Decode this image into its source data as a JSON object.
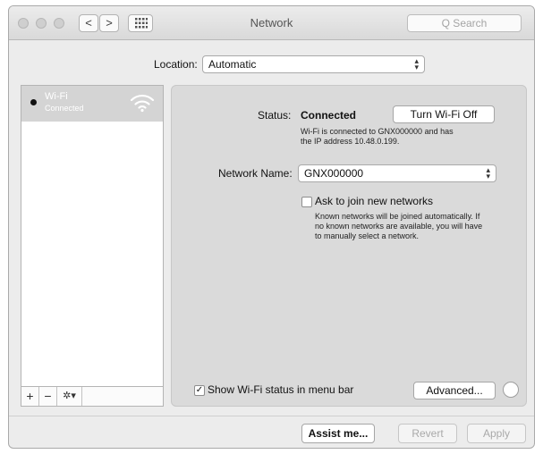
{
  "window": {
    "title": "Network"
  },
  "toolbar": {
    "back": "<",
    "forward": ">",
    "search_placeholder": "Q  Search"
  },
  "location": {
    "label": "Location:",
    "value": "Automatic"
  },
  "sidebar": {
    "items": [
      {
        "name": "Wi-Fi",
        "status": "Connected"
      }
    ],
    "add": "+",
    "remove": "−",
    "action": "✲▾"
  },
  "status": {
    "label": "Status:",
    "value": "Connected",
    "button": "Turn Wi-Fi Off",
    "desc_line1": "Wi-Fi is connected to GNX000000 and has",
    "desc_line2": "the IP address 10.48.0.199."
  },
  "network": {
    "label": "Network Name:",
    "value": "GNX000000",
    "ask_label": "Ask to join new networks",
    "ask_checked": false,
    "ask_desc_line1": "Known networks will be joined automatically. If",
    "ask_desc_line2": "no known networks are available, you will have",
    "ask_desc_line3": "to manually select a network."
  },
  "show_status": {
    "label": "Show Wi-Fi status in menu bar",
    "checked": true,
    "check_glyph": "✓"
  },
  "buttons": {
    "advanced": "Advanced...",
    "assist": "Assist me...",
    "revert": "Revert",
    "apply": "Apply"
  },
  "colors": {
    "window_bg": "#ececec",
    "panel_bg": "#dadada",
    "selected_item": "#d4d4d4"
  }
}
